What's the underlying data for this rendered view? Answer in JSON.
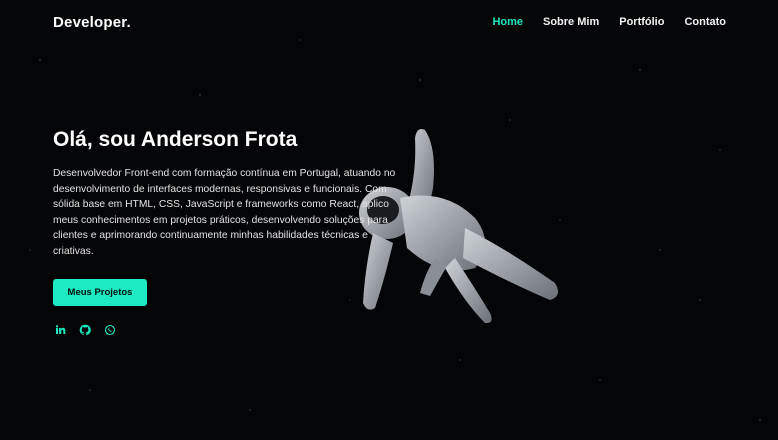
{
  "header": {
    "logo": "Developer.",
    "nav": [
      {
        "label": "Home",
        "active": true
      },
      {
        "label": "Sobre Mim",
        "active": false
      },
      {
        "label": "Portfólio",
        "active": false
      },
      {
        "label": "Contato",
        "active": false
      }
    ]
  },
  "hero": {
    "title": "Olá, sou Anderson Frota",
    "description": "Desenvolvedor Front-end com formação contínua em Portugal, atuando no desenvolvimento de interfaces modernas, responsivas e funcionais. Com sólida base em HTML, CSS, JavaScript e frameworks como React, aplico meus conhecimentos em projetos práticos, desenvolvendo soluções para clientes e aprimorando continuamente minhas habilidades técnicas e criativas.",
    "cta_label": "Meus Projetos"
  },
  "socials": [
    {
      "icon": "linkedin-icon"
    },
    {
      "icon": "github-icon"
    },
    {
      "icon": "whatsapp-icon"
    }
  ],
  "colors": {
    "accent": "#1de9c2",
    "background": "#050608"
  }
}
